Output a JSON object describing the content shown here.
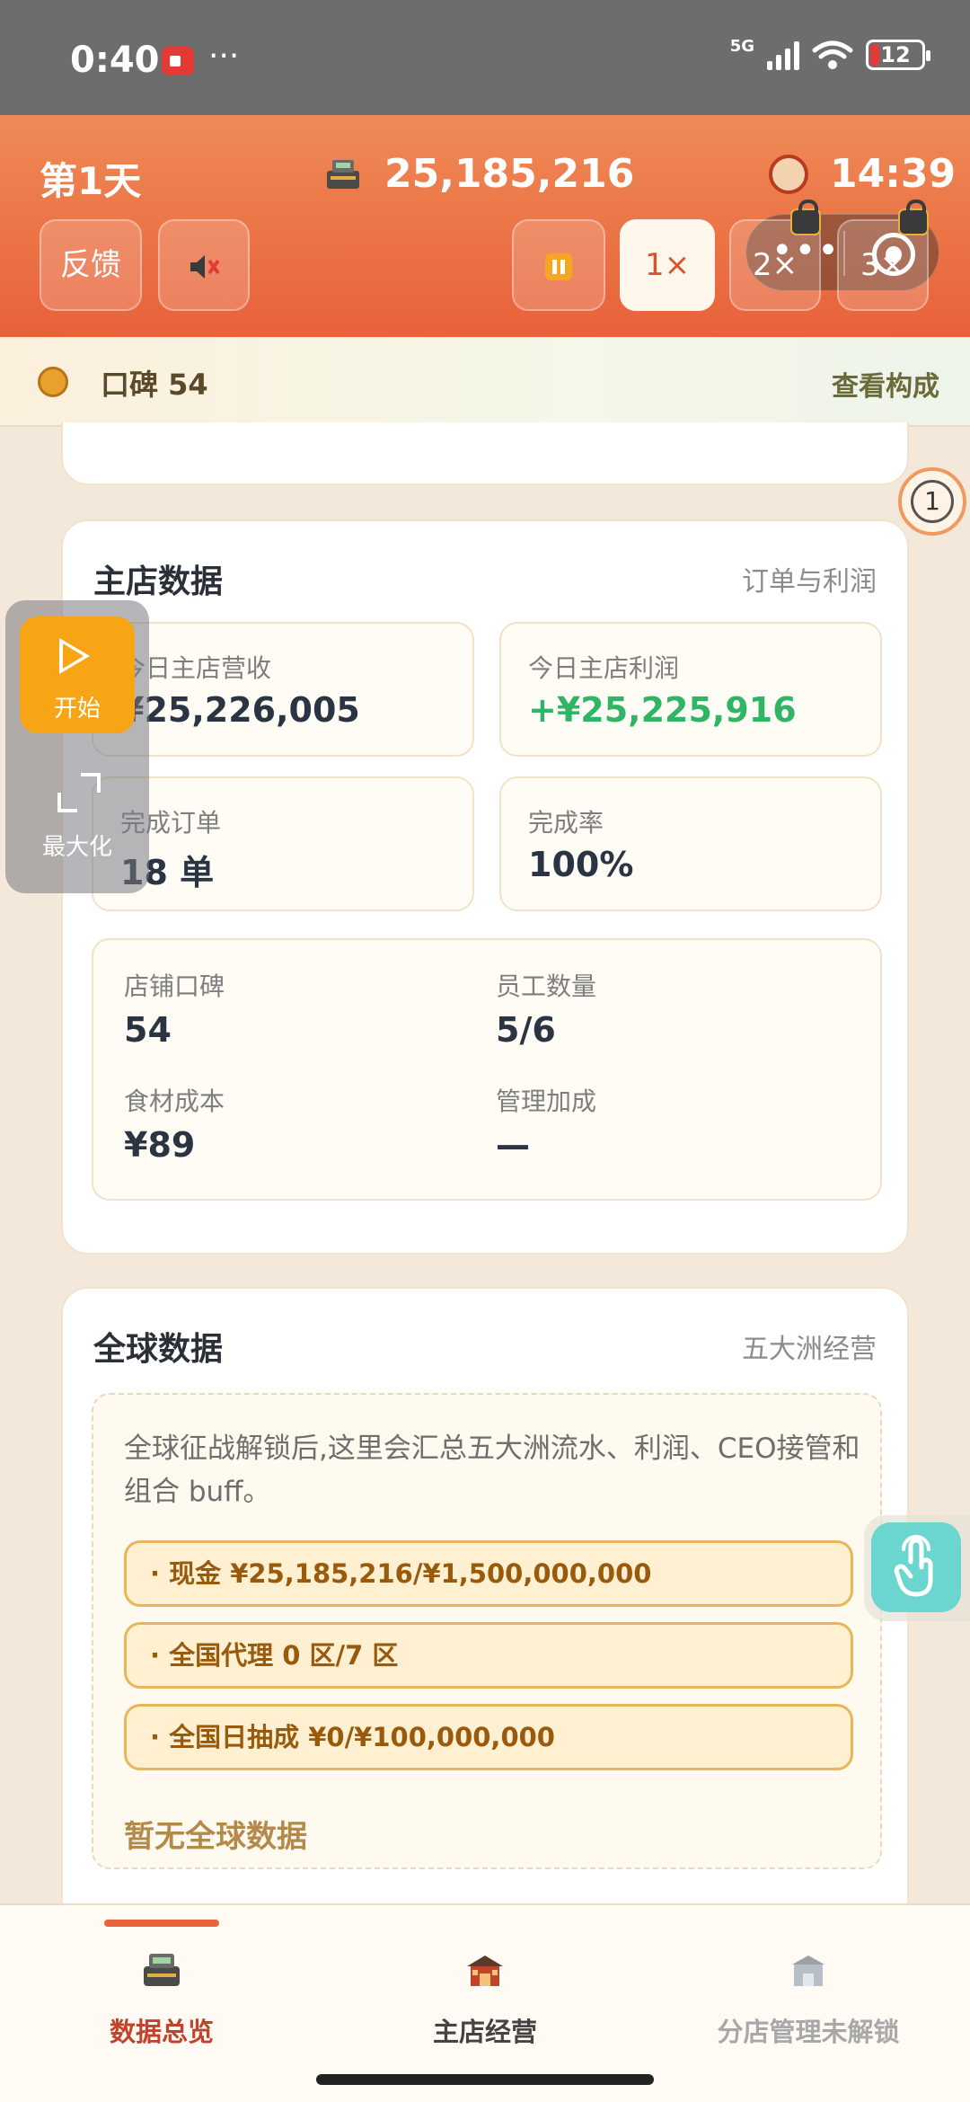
{
  "status_bar": {
    "time": "0:40",
    "dots": "···",
    "network": "5G",
    "battery": "12"
  },
  "header": {
    "day": "第1天",
    "cash": "25,185,216",
    "clock": "14:39",
    "feedback_label": "反馈",
    "speed_1x": "1×",
    "speed_2x": "2×",
    "speed_3x": "3×",
    "capsule_more": "•••"
  },
  "reputation": {
    "label": "口碑 54",
    "link": "查看构成"
  },
  "main_store": {
    "title": "主店数据",
    "link": "订单与利润",
    "revenue": {
      "label": "今日主店营收",
      "value": "¥25,226,005"
    },
    "profit": {
      "label": "今日主店利润",
      "value": "+¥25,225,916"
    },
    "orders": {
      "label": "完成订单",
      "value": "18 单"
    },
    "completion": {
      "label": "完成率",
      "value": "100%"
    },
    "details": {
      "reputation_label": "店铺口碑",
      "reputation_value": "54",
      "staff_label": "员工数量",
      "staff_value": "5/6",
      "cost_label": "食材成本",
      "cost_value": "¥89",
      "bonus_label": "管理加成",
      "bonus_value": "—"
    }
  },
  "global": {
    "title": "全球数据",
    "link": "五大洲经营",
    "description": "全球征战解锁后,这里会汇总五大洲流水、利润、CEO接管和组合 buff。",
    "requirements": [
      "· 现金 ¥25,185,216/¥1,500,000,000",
      "· 全国代理 0 区/7 区",
      "· 全国日抽成 ¥0/¥100,000,000"
    ],
    "empty": "暂无全球数据"
  },
  "float_panel": {
    "start_label": "开始",
    "maximize_label": "最大化"
  },
  "badge": {
    "count": "1"
  },
  "tabs": [
    {
      "label": "数据总览",
      "active": true
    },
    {
      "label": "主店经营",
      "active": false
    },
    {
      "label": "分店管理未解锁",
      "active": false
    }
  ],
  "colors": {
    "accent": "#e8633b",
    "profit_green": "#2fb565",
    "pill_text": "#9a5a0c"
  }
}
